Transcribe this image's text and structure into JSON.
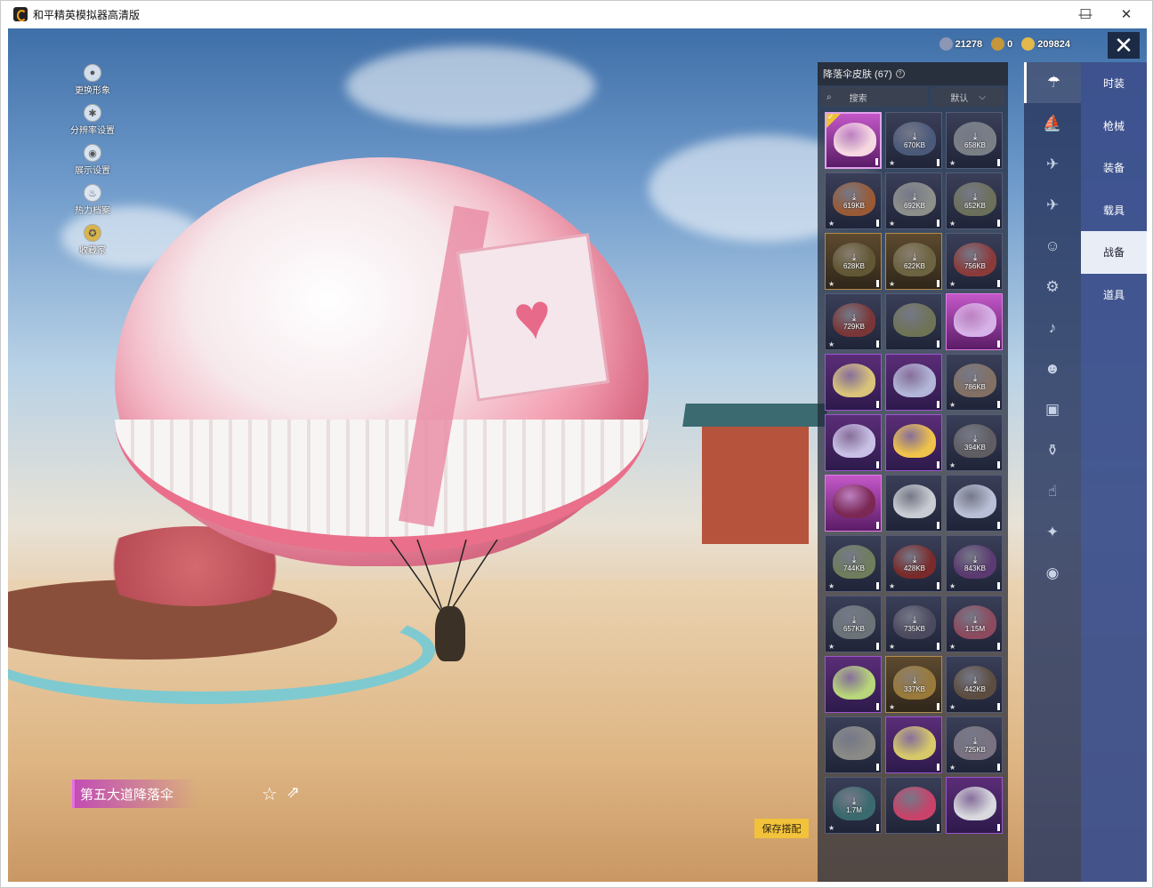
{
  "window": {
    "title": "和平精英模拟器高清版",
    "minimize": "—",
    "maximize": "☐",
    "close": "✕"
  },
  "left_menu": [
    {
      "label": "更换形象",
      "icon": "person-icon"
    },
    {
      "label": "分辨率设置",
      "icon": "gear-icon"
    },
    {
      "label": "展示设置",
      "icon": "eye-icon"
    },
    {
      "label": "热力档案",
      "icon": "flame-icon"
    },
    {
      "label": "收藏家",
      "icon": "badge-icon"
    }
  ],
  "currency": [
    {
      "value": "21278",
      "color": "#8c97b6"
    },
    {
      "value": "0",
      "color": "#c5963a"
    },
    {
      "value": "209824",
      "color": "#e2b94a"
    }
  ],
  "close_symbol": "✕",
  "panel": {
    "title": "降落伞皮肤 (67)",
    "help": "?",
    "search_placeholder": "搜索",
    "search_icon": "⌕",
    "sort": "默认",
    "sort_arrow": "⌵"
  },
  "tiles": [
    {
      "size": "",
      "style": "pink",
      "color": "#f6d8e2",
      "selected": true
    },
    {
      "size": "670KB",
      "style": "",
      "color": "#4b5a7a"
    },
    {
      "size": "658KB",
      "style": "",
      "color": "#7a7f86"
    },
    {
      "size": "619KB",
      "style": "",
      "color": "#9a5a36"
    },
    {
      "size": "692KB",
      "style": "",
      "color": "#8d8f8b"
    },
    {
      "size": "652KB",
      "style": "",
      "color": "#6c705a"
    },
    {
      "size": "628KB",
      "style": "gold",
      "color": "#615735"
    },
    {
      "size": "622KB",
      "style": "gold",
      "color": "#6c6340"
    },
    {
      "size": "756KB",
      "style": "",
      "color": "#8b3a3a"
    },
    {
      "size": "729KB",
      "style": "",
      "color": "#7a3636"
    },
    {
      "size": "",
      "style": "",
      "color": "#6f7356"
    },
    {
      "size": "",
      "style": "pink",
      "color": "#d7b2e8"
    },
    {
      "size": "",
      "style": "purple",
      "color": "#d9c37a"
    },
    {
      "size": "",
      "style": "purple",
      "color": "#b2b6d8"
    },
    {
      "size": "786KB",
      "style": "",
      "color": "#837064"
    },
    {
      "size": "",
      "style": "purple",
      "color": "#c9c0e6"
    },
    {
      "size": "",
      "style": "purple",
      "color": "#f0c34a"
    },
    {
      "size": "394KB",
      "style": "",
      "color": "#5f5d62"
    },
    {
      "size": "",
      "style": "pink",
      "color": "#7b2854"
    },
    {
      "size": "",
      "style": "",
      "color": "#c9ccd2"
    },
    {
      "size": "",
      "style": "",
      "color": "#b9bfd6"
    },
    {
      "size": "744KB",
      "style": "",
      "color": "#6f7d5c"
    },
    {
      "size": "428KB",
      "style": "",
      "color": "#7a2a2a"
    },
    {
      "size": "843KB",
      "style": "",
      "color": "#5a3a70"
    },
    {
      "size": "657KB",
      "style": "",
      "color": "#6b7378"
    },
    {
      "size": "735KB",
      "style": "",
      "color": "#4c4a5e"
    },
    {
      "size": "1.15M",
      "style": "",
      "color": "#8c4a5e"
    },
    {
      "size": "",
      "style": "purple",
      "color": "#b8d67a"
    },
    {
      "size": "337KB",
      "style": "gold",
      "color": "#9a7a3a"
    },
    {
      "size": "442KB",
      "style": "",
      "color": "#5c4d40"
    },
    {
      "size": "",
      "style": "",
      "color": "#8a8a86"
    },
    {
      "size": "",
      "style": "purple",
      "color": "#d7c96a"
    },
    {
      "size": "725KB",
      "style": "",
      "color": "#7a7280"
    },
    {
      "size": "1.7M",
      "style": "",
      "color": "#3a6a6e"
    },
    {
      "size": "",
      "style": "",
      "color": "#c9426a"
    },
    {
      "size": "",
      "style": "purple",
      "color": "#d8d8de"
    }
  ],
  "side_icons": [
    "parachute-icon",
    "boat-icon",
    "drone-icon",
    "plane-icon",
    "face-icon",
    "robot-icon",
    "speaker-icon",
    "emote-icon",
    "image-icon",
    "extinguisher-icon",
    "hand-icon",
    "wand-icon",
    "vehicle-icon"
  ],
  "side_icon_glyphs": [
    "☂",
    "⛵",
    "✈",
    "✈",
    "☺",
    "⚙",
    "♪",
    "☻",
    "▣",
    "⚱",
    "☝",
    "✦",
    "◉"
  ],
  "categories": [
    "时装",
    "枪械",
    "装备",
    "载具",
    "战备",
    "道具"
  ],
  "active_category": "战备",
  "skin_name": "第五大道降落伞",
  "fav_symbol": "☆",
  "share_symbol": "⇗",
  "save_button": "保存搭配"
}
